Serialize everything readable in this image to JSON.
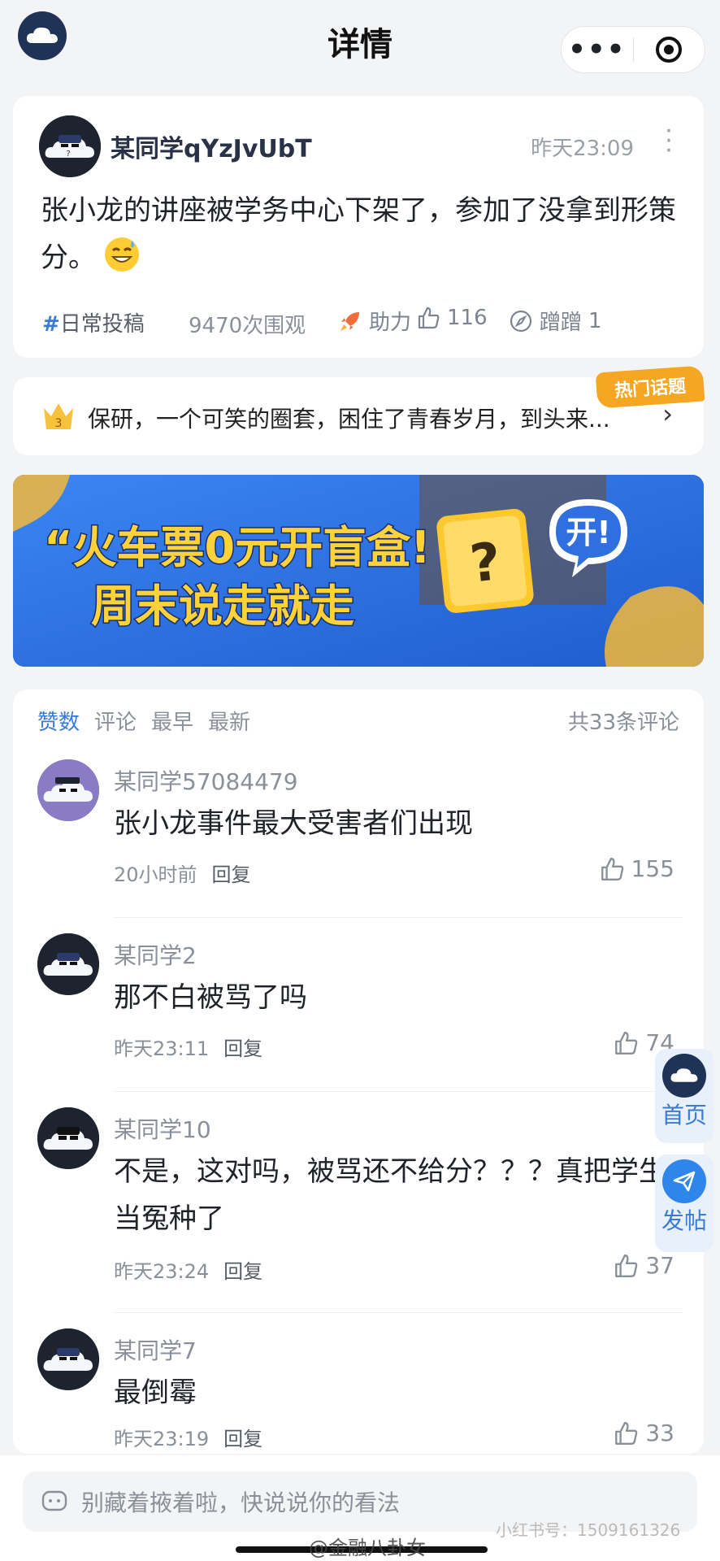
{
  "header": {
    "title": "详情",
    "more_icon": "more-dots-icon",
    "target_icon": "target-icon"
  },
  "post": {
    "author": "某同学qYzJvUbT",
    "time": "昨天23:09",
    "content": "张小龙的讲座被学务中心下架了，参加了没拿到形策分。",
    "tag_hash": "#",
    "tag": "日常投稿",
    "views": "9470次围观",
    "boost_label": "助力",
    "likes": "116",
    "cengceng_label": "蹭蹭",
    "cengceng_count": "1"
  },
  "topic": {
    "rank": "3",
    "text": "保研，一个可笑的圈套，困住了青春岁月，到头来...",
    "badge": "热门话题"
  },
  "banner": {
    "line1": "“火车票0元开盲盒!",
    "line2": "周末说走就走",
    "bubble": "开!",
    "mystery": "?",
    "accent_color": "#ffd23a"
  },
  "comments_section": {
    "tabs": [
      "赞数",
      "评论",
      "最早",
      "最新"
    ],
    "total": "共33条评论",
    "comments": [
      {
        "name": "某同学57084479",
        "text": "张小龙事件最大受害者们出现",
        "time": "20小时前",
        "reply": "回复",
        "likes": "155"
      },
      {
        "name": "某同学2",
        "text": "那不白被骂了吗",
        "time": "昨天23:11",
        "reply": "回复",
        "likes": "74"
      },
      {
        "name": "某同学10",
        "text": "不是，这对吗，被骂还不给分？？？真把学生当冤种了",
        "time": "昨天23:24",
        "reply": "回复",
        "likes": "37"
      },
      {
        "name": "某同学7",
        "text": "最倒霉",
        "time": "昨天23:19",
        "reply": "回复",
        "likes": "33"
      }
    ]
  },
  "float": {
    "home": "首页",
    "post": "发帖"
  },
  "input": {
    "placeholder": "别藏着掖着啦，快说说你的看法"
  },
  "watermark": "@金融八卦女",
  "watermark2": "小红书号：1509161326"
}
